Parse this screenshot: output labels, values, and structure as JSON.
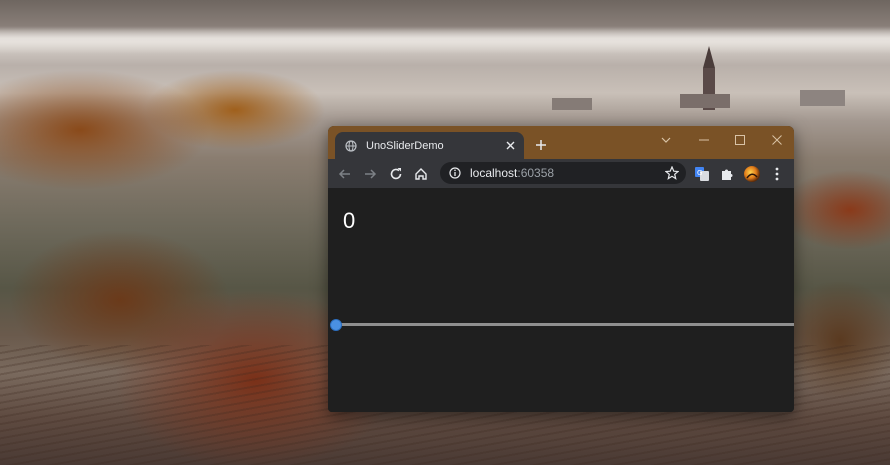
{
  "browser": {
    "tab_title": "UnoSliderDemo",
    "url_host": "localhost",
    "url_port": ":60358"
  },
  "app": {
    "value_display": "0",
    "slider": {
      "value": 0,
      "min": 0
    }
  },
  "colors": {
    "titlebar": "#7a5226",
    "tab": "#35363a",
    "toolbar": "#35363a",
    "content_bg": "#1f1f1f",
    "slider_thumb": "#4a90e2",
    "slider_track": "#8f8f8f"
  },
  "icons": [
    "globe-icon",
    "close-icon",
    "plus-icon",
    "chevron-down-icon",
    "minimize-icon",
    "maximize-icon",
    "window-close-icon",
    "back-arrow-icon",
    "forward-arrow-icon",
    "reload-icon",
    "home-icon",
    "info-icon",
    "star-icon",
    "translate-icon",
    "puzzle-icon",
    "avatar",
    "kebab-menu-icon"
  ]
}
